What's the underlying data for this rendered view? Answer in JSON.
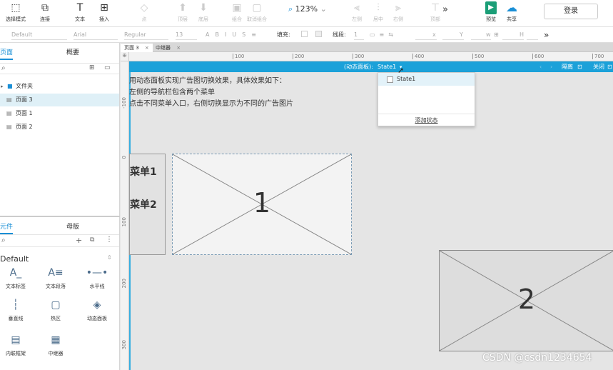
{
  "toolbar": {
    "tools": [
      {
        "label": "选择模式",
        "icon": "select-mode-icon",
        "glyph": "⬚"
      },
      {
        "label": "连接",
        "icon": "connect-icon",
        "glyph": "⧉"
      },
      {
        "label": "文本",
        "icon": "text-icon",
        "glyph": "T"
      },
      {
        "label": "插入",
        "icon": "insert-icon",
        "glyph": "⊞"
      },
      {
        "label": "点",
        "icon": "point-icon",
        "glyph": "◇"
      },
      {
        "label": "顶层",
        "icon": "top-layer-icon",
        "glyph": "⬆"
      },
      {
        "label": "底层",
        "icon": "bottom-layer-icon",
        "glyph": "⬇"
      },
      {
        "label": "组合",
        "icon": "group-icon",
        "glyph": "▣"
      },
      {
        "label": "取消组合",
        "icon": "ungroup-icon",
        "glyph": "▢"
      },
      {
        "label": "左侧",
        "icon": "align-left-icon",
        "glyph": "⫷"
      },
      {
        "label": "居中",
        "icon": "align-center-icon",
        "glyph": "⫶"
      },
      {
        "label": "右侧",
        "icon": "align-right-icon",
        "glyph": "⫸"
      },
      {
        "label": "顶部",
        "icon": "align-top-icon",
        "glyph": "⊤"
      },
      {
        "label": "预览",
        "icon": "preview-icon",
        "glyph": "▶"
      },
      {
        "label": "共享",
        "icon": "share-icon",
        "glyph": "☁"
      }
    ],
    "zoom": "123%",
    "more": "»",
    "login": "登录"
  },
  "format": {
    "style": "Default",
    "font": "Arial",
    "weight": "Regular",
    "size": "13",
    "fill_label": "填充:",
    "line_label": "线段:",
    "line_value": "1",
    "x_label": "x",
    "y_label": "Y",
    "w_label": "w",
    "h_label": "H",
    "more": "»"
  },
  "pages": {
    "tab_pages": "页面",
    "tab_outline": "概要",
    "items": [
      {
        "label": "文件夹",
        "type": "folder"
      },
      {
        "label": "页面 3",
        "type": "page",
        "selected": true
      },
      {
        "label": "页面 1",
        "type": "page"
      },
      {
        "label": "页面 2",
        "type": "page"
      }
    ]
  },
  "widgets": {
    "tab_widgets": "元件",
    "tab_masters": "母版",
    "library": "Default",
    "items": [
      {
        "label": "文本标签",
        "icon": "text-label-icon",
        "glyph": "A_"
      },
      {
        "label": "文本段落",
        "icon": "text-paragraph-icon",
        "glyph": "A≡"
      },
      {
        "label": "水平线",
        "icon": "horizontal-line-icon",
        "glyph": "•—•"
      },
      {
        "label": "垂直线",
        "icon": "vertical-line-icon",
        "glyph": "┆"
      },
      {
        "label": "热区",
        "icon": "hotspot-icon",
        "glyph": "▢"
      },
      {
        "label": "动态面板",
        "icon": "dynamic-panel-icon",
        "glyph": "◈"
      },
      {
        "label": "内联框架",
        "icon": "inline-frame-icon",
        "glyph": "▤"
      },
      {
        "label": "中继器",
        "icon": "repeater-icon",
        "glyph": "▦"
      }
    ]
  },
  "canvas": {
    "tabs": [
      {
        "label": "页面 3",
        "close": "×"
      },
      {
        "label": "中继器",
        "close": "×"
      }
    ],
    "ruler_h": [
      "100",
      "200",
      "300",
      "400",
      "500",
      "600",
      "700"
    ],
    "ruler_v": [
      "-100",
      "0",
      "100",
      "200",
      "300"
    ],
    "panel_bar": {
      "prefix": "(动态面板):",
      "state": "State1",
      "isolate": "隔离",
      "close": "关闭"
    },
    "notes": [
      "用动态面板实现广告图切换效果，具体效果如下：",
      "左侧的导航栏包含两个菜单",
      "点击不同菜单入口，右侧切换显示为不同的广告图片"
    ],
    "menu": [
      "菜单1",
      "菜单2"
    ],
    "placeholder_1": "1",
    "placeholder_2": "2",
    "dropdown": {
      "item": "State1",
      "add": "添加状态"
    }
  },
  "watermark": "CSDN @csdn1234654"
}
